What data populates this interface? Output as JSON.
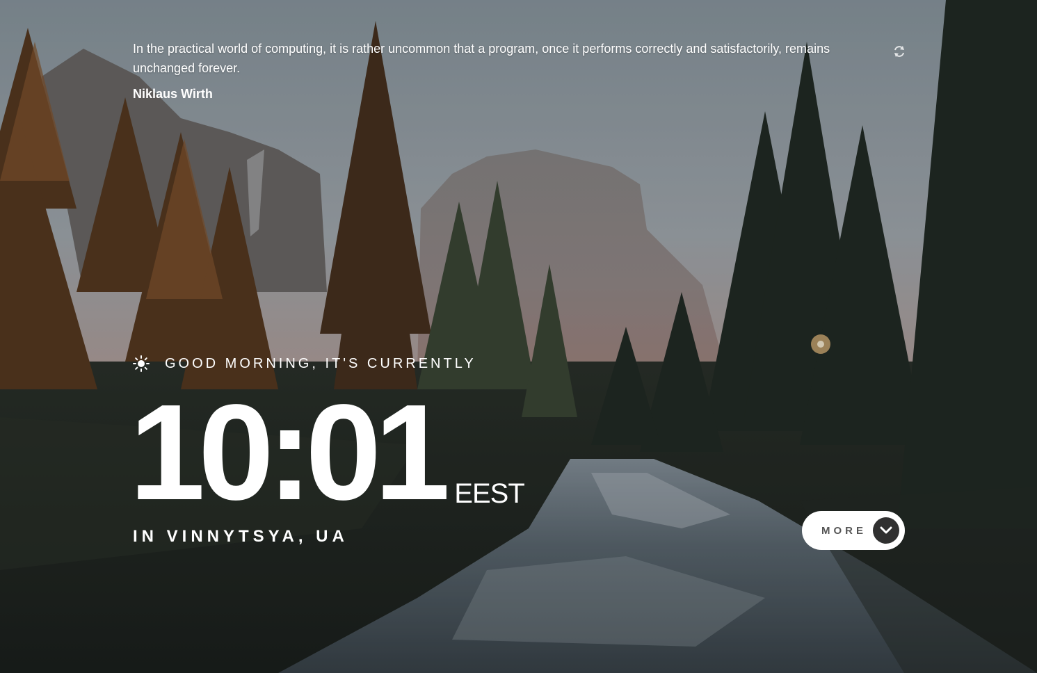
{
  "quote": {
    "text": "In the practical world of computing, it is rather uncommon that a program, once it performs correctly and satisfactorily, remains unchanged forever.",
    "author": "Niklaus Wirth",
    "refresh_icon": "refresh-icon"
  },
  "greeting": {
    "icon": "sun-icon",
    "text": "GOOD MORNING, IT'S CURRENTLY"
  },
  "clock": {
    "time": "10:01",
    "zone": "EEST"
  },
  "location": {
    "text": "IN VINNYTSYA, UA"
  },
  "more_button": {
    "label": "MORE",
    "icon": "chevron-down-icon"
  },
  "colors": {
    "text": "#ffffff",
    "button_bg": "#ffffff",
    "button_label": "#555555",
    "button_icon_bg": "#303030"
  }
}
